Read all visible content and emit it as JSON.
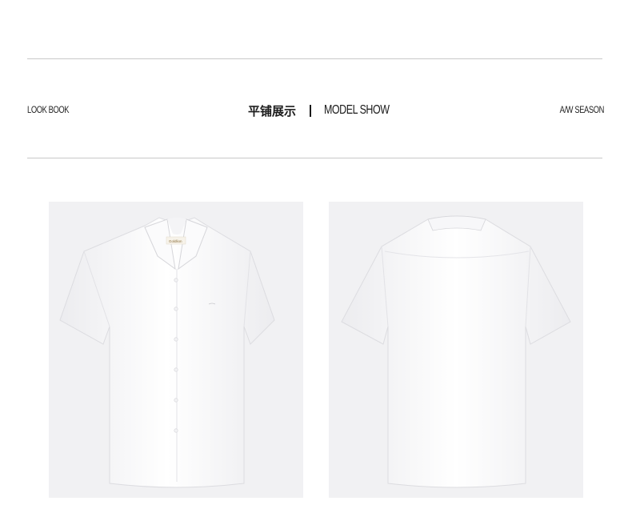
{
  "section": {
    "left_label": "LOOK BOOK",
    "title_cn": "平铺展示",
    "title_en": "MODEL SHOW",
    "right_label": "A/W SEASON"
  },
  "images": [
    {
      "view": "front",
      "subject": "white short-sleeve shirt",
      "brand_label": "Goldlion"
    },
    {
      "view": "back",
      "subject": "white short-sleeve shirt"
    }
  ],
  "colors": {
    "rule": "#c9c9c9",
    "photo_bg": "#f1f1f3",
    "shirt": "#ffffff",
    "text": "#1a1a1a"
  }
}
